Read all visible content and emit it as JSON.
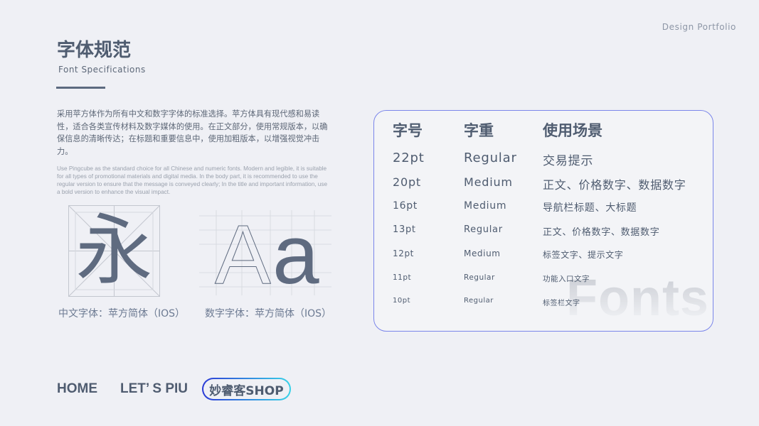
{
  "brand": "Design Portfolio",
  "header": {
    "title": "字体规范",
    "subtitle": "Font Specifications"
  },
  "description": {
    "cn": "采用苹方体作为所有中文和数字字体的标准选择。苹方体具有现代感和易读性，适合各类宣传材料及数字媒体的使用。在正文部分，使用常规版本，以确保信息的清晰传达；在标题和重要信息中，使用加粗版本，以增强视觉冲击力。",
    "en": "Use Pingcube as the standard choice for all Chinese and numeric fonts. Modern and legible, it is suitable for all types of promotional materials and digital media. In the body part, it is recommended to use the regular version to ensure that the message is conveyed clearly; In the title and important information, use a bold version to enhance the visual impact."
  },
  "samples": {
    "cn_glyph": "永",
    "latin_upper": "A",
    "latin_lower": "a",
    "cn_caption": "中文字体：苹方简体（IOS）",
    "num_caption": "数字字体：苹方简体（IOS）"
  },
  "spec_table": {
    "headers": [
      "字号",
      "字重",
      "使用场景"
    ],
    "rows": [
      {
        "size": "22pt",
        "weight": "Regular",
        "usage": "交易提示"
      },
      {
        "size": "20pt",
        "weight": "Medium",
        "usage": "正文、价格数字、数据数字"
      },
      {
        "size": "16pt",
        "weight": "Medium",
        "usage": "导航栏标题、大标题"
      },
      {
        "size": "13pt",
        "weight": "Regular",
        "usage": "正文、价格数字、数据数字"
      },
      {
        "size": "12pt",
        "weight": "Medium",
        "usage": "标签文字、提示文字"
      },
      {
        "size": "11pt",
        "weight": "Regular",
        "usage": "功能入口文字"
      },
      {
        "size": "10pt",
        "weight": "Regular",
        "usage": "标签栏文字"
      }
    ],
    "watermark": "Fonts"
  },
  "nav": {
    "home": "HOME",
    "lets_piu": "LET’ S PIU",
    "shop": "妙睿客SHOP"
  },
  "colors": {
    "background": "#eff0f5",
    "text": "#4f5c70",
    "card_border": "#7b86ea",
    "shop_gradient_start": "#2b3ad6",
    "shop_gradient_end": "#39d3e8"
  }
}
